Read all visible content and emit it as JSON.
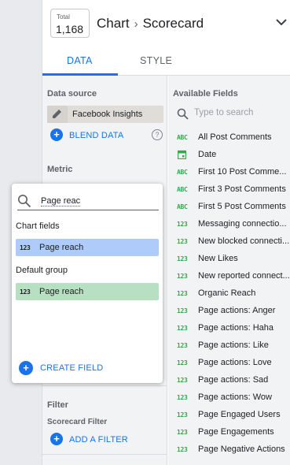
{
  "header": {
    "total_label": "Total",
    "total_value": "1,168",
    "crumb_parent": "Chart",
    "crumb_sep": "›",
    "crumb_current": "Scorecard"
  },
  "tabs": {
    "data": "DATA",
    "style": "STYLE"
  },
  "config": {
    "data_source_title": "Data source",
    "data_source_name": "Facebook Insights",
    "blend_label": "BLEND DATA",
    "help_glyph": "?",
    "metric_title": "Metric",
    "filter_title": "Filter",
    "scorecard_filter_label": "Scorecard Filter",
    "add_filter_label": "ADD A FILTER"
  },
  "available": {
    "title": "Available Fields",
    "search_placeholder": "Type to search",
    "items": [
      {
        "type": "ABC",
        "name": "All Post Comments"
      },
      {
        "type": "DATE",
        "name": "Date"
      },
      {
        "type": "ABC",
        "name": "First 10 Post Comme..."
      },
      {
        "type": "ABC",
        "name": "First 3 Post Comments"
      },
      {
        "type": "ABC",
        "name": "First 5 Post Comments"
      },
      {
        "type": "123",
        "name": "Messaging connectio..."
      },
      {
        "type": "123",
        "name": "New blocked connecti..."
      },
      {
        "type": "123",
        "name": "New Likes"
      },
      {
        "type": "123",
        "name": "New reported connect..."
      },
      {
        "type": "123",
        "name": "Organic Reach"
      },
      {
        "type": "123",
        "name": "Page actions: Anger"
      },
      {
        "type": "123",
        "name": "Page actions: Haha"
      },
      {
        "type": "123",
        "name": "Page actions: Like"
      },
      {
        "type": "123",
        "name": "Page actions: Love"
      },
      {
        "type": "123",
        "name": "Page actions: Sad"
      },
      {
        "type": "123",
        "name": "Page actions: Wow"
      },
      {
        "type": "123",
        "name": "Page Engaged Users"
      },
      {
        "type": "123",
        "name": "Page Engagements"
      },
      {
        "type": "123",
        "name": "Page Negative Actions"
      }
    ]
  },
  "popup": {
    "search_value": "Page reac",
    "chart_fields_label": "Chart fields",
    "chart_field": {
      "type": "123",
      "name": "Page reach"
    },
    "default_group_label": "Default group",
    "default_field": {
      "type": "123",
      "name": "Page reach"
    },
    "create_field_label": "CREATE FIELD"
  },
  "colors": {
    "accent": "#1a73e8",
    "field_green": "#34a853",
    "highlight_blue": "#aecbfa",
    "highlight_green": "#b7dfc1"
  }
}
